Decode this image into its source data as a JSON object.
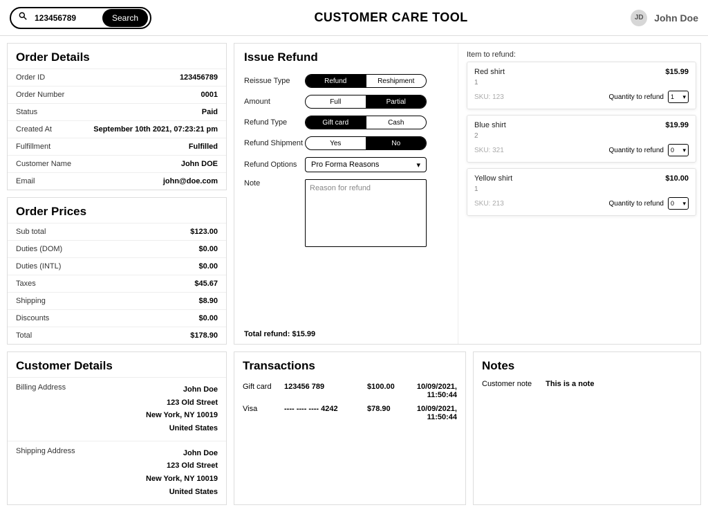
{
  "header": {
    "search_value": "123456789",
    "search_button": "Search",
    "title": "CUSTOMER CARE TOOL",
    "user_initials": "JD",
    "user_name": "John Doe"
  },
  "order_details": {
    "heading": "Order Details",
    "rows": [
      {
        "k": "Order ID",
        "v": "123456789"
      },
      {
        "k": "Order Number",
        "v": "0001"
      },
      {
        "k": "Status",
        "v": "Paid"
      },
      {
        "k": "Created At",
        "v": "September 10th 2021, 07:23:21 pm"
      },
      {
        "k": "Fulfillment",
        "v": "Fulfilled"
      },
      {
        "k": "Customer Name",
        "v": "John DOE"
      },
      {
        "k": "Email",
        "v": "john@doe.com"
      }
    ]
  },
  "order_prices": {
    "heading": "Order Prices",
    "rows": [
      {
        "k": "Sub total",
        "v": "$123.00"
      },
      {
        "k": "Duties (DOM)",
        "v": "$0.00"
      },
      {
        "k": "Duties (INTL)",
        "v": "$0.00"
      },
      {
        "k": "Taxes",
        "v": "$45.67"
      },
      {
        "k": "Shipping",
        "v": "$8.90"
      },
      {
        "k": "Discounts",
        "v": "$0.00"
      },
      {
        "k": "Total",
        "v": "$178.90"
      }
    ]
  },
  "refund": {
    "heading": "Issue Refund",
    "labels": {
      "reissue_type": "Reissue Type",
      "amount": "Amount",
      "refund_type": "Refund Type",
      "refund_shipment": "Refund Shipment",
      "refund_options": "Refund Options",
      "note": "Note",
      "item_to_refund": "Item to refund:",
      "qty_to_refund": "Quantity to refund",
      "total_prefix": "Total refund: ",
      "total_value": "$15.99"
    },
    "reissue": {
      "a": "Refund",
      "b": "Reshipment",
      "active": "a"
    },
    "amount": {
      "a": "Full",
      "b": "Partial",
      "active": "b"
    },
    "rtype": {
      "a": "Gift card",
      "b": "Cash",
      "active": "a"
    },
    "rship": {
      "a": "Yes",
      "b": "No",
      "active": "b"
    },
    "options_selected": "Pro Forma Reasons",
    "note_placeholder": "Reason for refund",
    "items": [
      {
        "name": "Red shirt",
        "price": "$15.99",
        "qty": "1",
        "sku": "SKU: 123",
        "sel": "1"
      },
      {
        "name": "Blue shirt",
        "price": "$19.99",
        "qty": "2",
        "sku": "SKU: 321",
        "sel": "0"
      },
      {
        "name": "Yellow shirt",
        "price": "$10.00",
        "qty": "1",
        "sku": "SKU: 213",
        "sel": "0"
      }
    ]
  },
  "customer_details": {
    "heading": "Customer Details",
    "billing_label": "Billing Address",
    "shipping_label": "Shipping Address",
    "billing": [
      "John Doe",
      "123 Old Street",
      "New York, NY 10019",
      "United States"
    ],
    "shipping": [
      "John Doe",
      "123 Old Street",
      "New York, NY 10019",
      "United States"
    ]
  },
  "transactions": {
    "heading": "Transactions",
    "rows": [
      {
        "method": "Gift card",
        "number": "123456 789",
        "amount": "$100.00",
        "ts": "10/09/2021, 11:50:44"
      },
      {
        "method": "Visa",
        "number": "---- ---- ---- 4242",
        "amount": "$78.90",
        "ts": "10/09/2021, 11:50:44"
      }
    ]
  },
  "notes": {
    "heading": "Notes",
    "label": "Customer note",
    "value": "This is a note"
  }
}
